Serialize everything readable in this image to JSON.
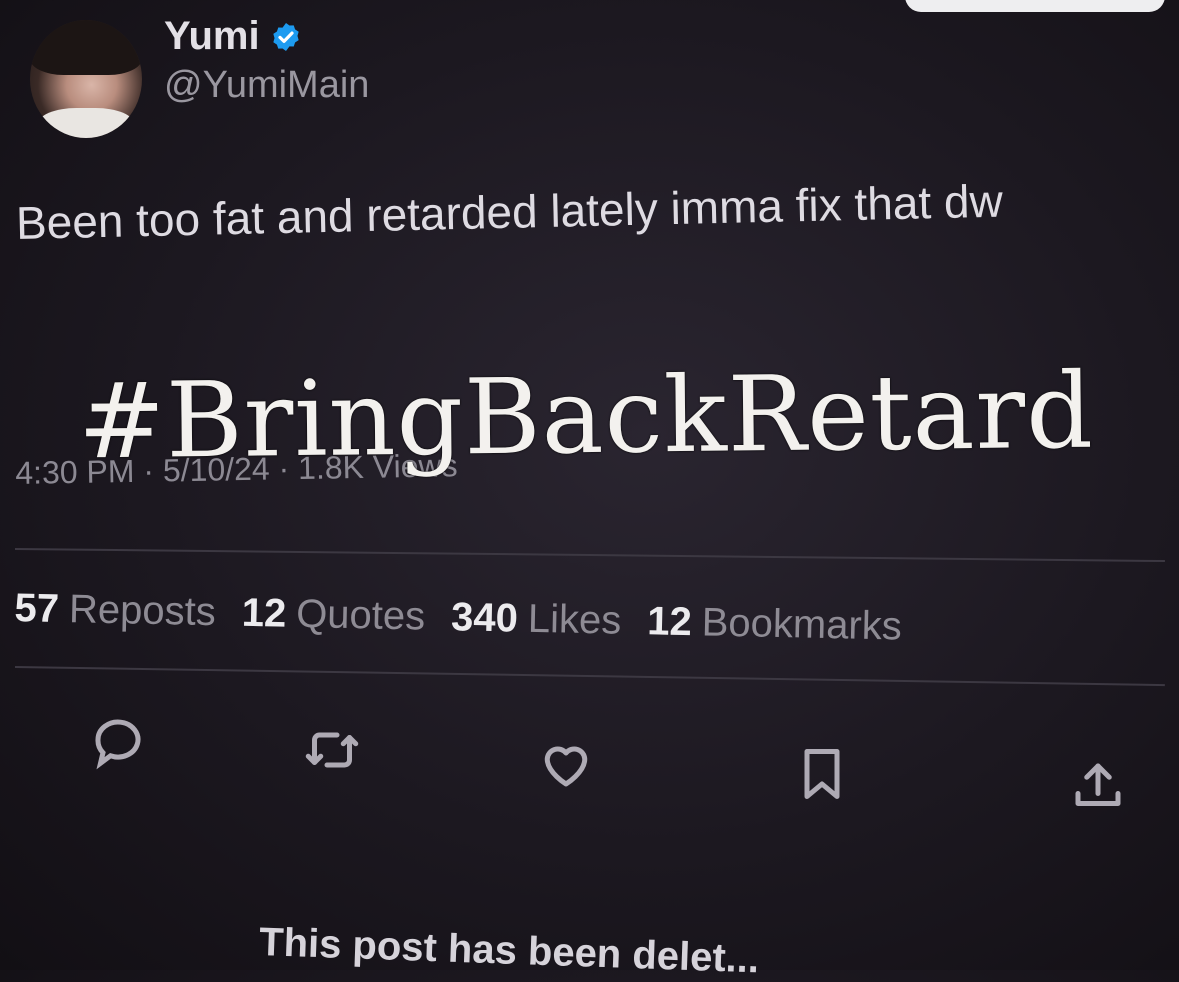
{
  "author": {
    "name": "Yumi",
    "handle": "@YumiMain",
    "verified": true
  },
  "tweet": {
    "text": "Been too fat and retarded lately imma fix that dw",
    "meta": "4:30 PM · 5/10/24 · 1.8K Views"
  },
  "overlay_text": "#BringBackRetard",
  "stats": [
    {
      "count": "57",
      "label": "Reposts"
    },
    {
      "count": "12",
      "label": "Quotes"
    },
    {
      "count": "340",
      "label": "Likes"
    },
    {
      "count": "12",
      "label": "Bookmarks"
    }
  ],
  "actions": [
    {
      "icon": "reply-icon"
    },
    {
      "icon": "repost-icon"
    },
    {
      "icon": "like-icon"
    },
    {
      "icon": "bookmark-icon"
    },
    {
      "icon": "share-icon"
    }
  ],
  "footer": {
    "deleted_notice": "This post has been delet..."
  },
  "colors": {
    "background": "#1c1820",
    "verified": "#1d9bf0",
    "text_primary": "#e7e4ea",
    "text_secondary": "#8e8b94"
  }
}
